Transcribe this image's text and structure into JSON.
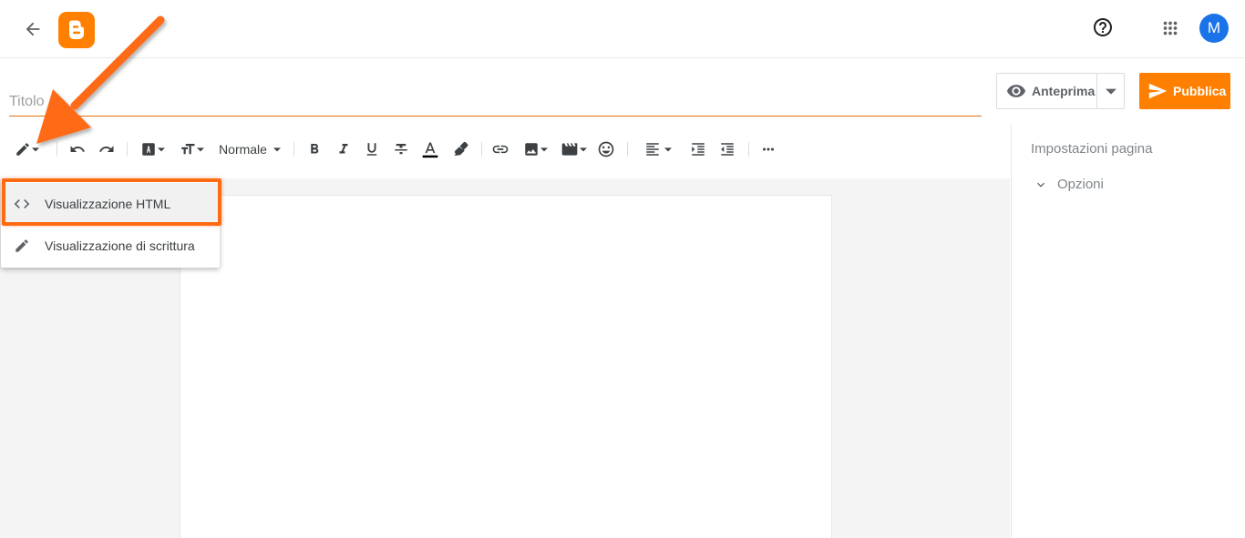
{
  "header": {
    "back_icon": "arrow-left-icon",
    "logo_icon": "blogger-logo-icon",
    "help_icon": "help-circle-icon",
    "apps_icon": "apps-grid-icon",
    "avatar_initial": "M",
    "avatar_color": "#1a73e8",
    "brand_color": "#ff8000"
  },
  "post": {
    "title_placeholder": "Titolo",
    "title_value": ""
  },
  "actions": {
    "preview_label": "Anteprima",
    "publish_label": "Pubblica"
  },
  "toolbar": {
    "paragraph_style": "Normale"
  },
  "view_menu": {
    "items": [
      {
        "label": "Visualizzazione HTML",
        "icon": "code-icon",
        "highlighted": true
      },
      {
        "label": "Visualizzazione di scrittura",
        "icon": "pencil-icon",
        "highlighted": false
      }
    ]
  },
  "sidebar": {
    "title": "Impostazioni pagina",
    "options_label": "Opzioni"
  },
  "annotation": {
    "color": "#ff6a13"
  }
}
